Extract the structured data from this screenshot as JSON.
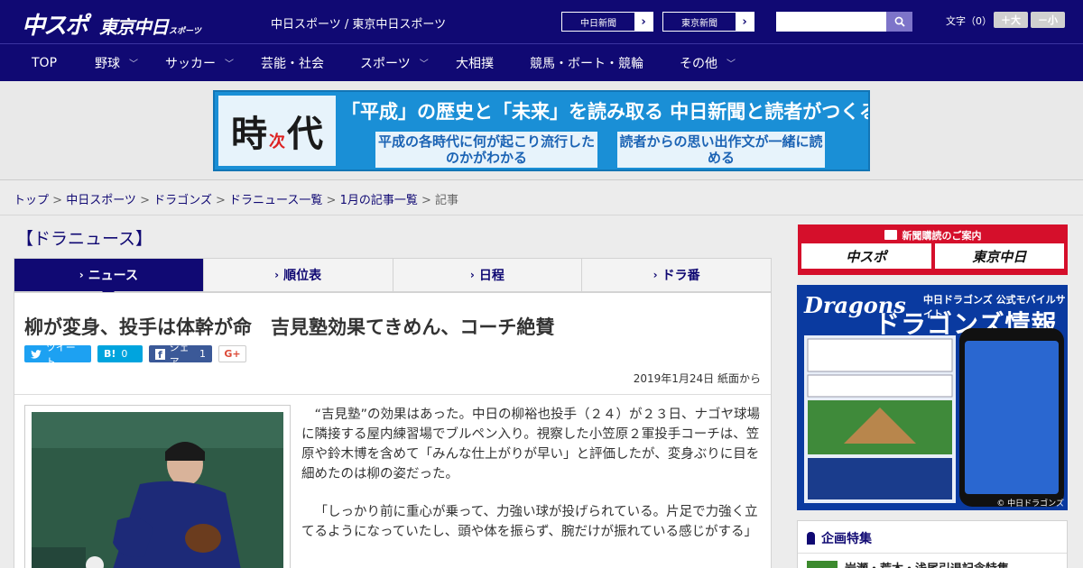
{
  "header": {
    "logo_main": "中スポ",
    "logo_secondary": "東京中日",
    "logo_suffix": "スポーツ",
    "site_name": "中日スポーツ / 東京中日スポーツ",
    "links": [
      {
        "label": "中日新聞"
      },
      {
        "label": "東京新聞"
      }
    ],
    "search": {
      "placeholder": "",
      "value": ""
    },
    "font_label": "文字（0）",
    "font_bigger": "＋大",
    "font_smaller": "－小",
    "colors": {
      "primary": "#100973",
      "search_button": "#7d74c9"
    }
  },
  "nav": {
    "items": [
      {
        "label": "TOP",
        "has_menu": false
      },
      {
        "label": "野球",
        "has_menu": true
      },
      {
        "label": "サッカー",
        "has_menu": true
      },
      {
        "label": "芸能・社会",
        "has_menu": false
      },
      {
        "label": "スポーツ",
        "has_menu": true
      },
      {
        "label": "大相撲",
        "has_menu": false
      },
      {
        "label": "競馬・ボート・競輪",
        "has_menu": false
      },
      {
        "label": "その他",
        "has_menu": true
      }
    ]
  },
  "banner": {
    "ji": "時",
    "tsugi": "次",
    "dai": "代",
    "headline": "「平成」の歴史と「未来」を読み取る 中日新聞と読者がつくるWebサイト",
    "box1": "平成の各時代に何が起こり流行したのかがわかる",
    "box2": "読者からの思い出作文が一緒に読める"
  },
  "breadcrumb": {
    "items": [
      "トップ",
      "中日スポーツ",
      "ドラゴンズ",
      "ドラニュース一覧",
      "1月の記事一覧"
    ],
    "current": "記事",
    "sep": " > "
  },
  "section": {
    "title": "【ドラニュース】"
  },
  "tabs": [
    {
      "label": "ニュース",
      "active": true
    },
    {
      "label": "順位表",
      "active": false
    },
    {
      "label": "日程",
      "active": false
    },
    {
      "label": "ドラ番",
      "active": false
    }
  ],
  "article": {
    "headline": "柳が変身、投手は体幹が命　吉見塾効果てきめん、コーチ絶賛",
    "share": {
      "tweet": "ツイート",
      "hatena_count": "0",
      "facebook": "シェア",
      "facebook_count": "1",
      "gplus": "G+",
      "colors": {
        "twitter": "#1da1f2",
        "hatena": "#00a4de",
        "facebook": "#3b5998"
      }
    },
    "date": "2019年1月24日 紙面から",
    "paragraphs": [
      "“吉見塾”の効果はあった。中日の柳裕也投手（２４）が２３日、ナゴヤ球場に隣接する屋内練習場でブルペン入り。視察した小笠原２軍投手コーチは、笠原や鈴木博を含めて「みんな仕上がりが早い」と評価したが、変身ぶりに目を細めたのは柳の姿だった。",
      "「しっかり前に重心が乗って、力強い球が投げられている。片足で力強く立てるようになっていたし、頭や体を振らず、腕だけが振れている感じがする」"
    ]
  },
  "sidebar": {
    "subscribe": {
      "title": "新聞購読のご案内",
      "left": "中スポ",
      "right": "東京中日"
    },
    "dragons_ad": {
      "logo": "Dragons",
      "subtitle": "中日ドラゴンズ 公式モバイルサイト",
      "title": "ドラゴンズ情報",
      "copyright": "© 中日ドラゴンズ"
    },
    "feature": {
      "title": "企画特集",
      "item": "岩瀬・荒木・浅尾引退記念特集"
    }
  }
}
